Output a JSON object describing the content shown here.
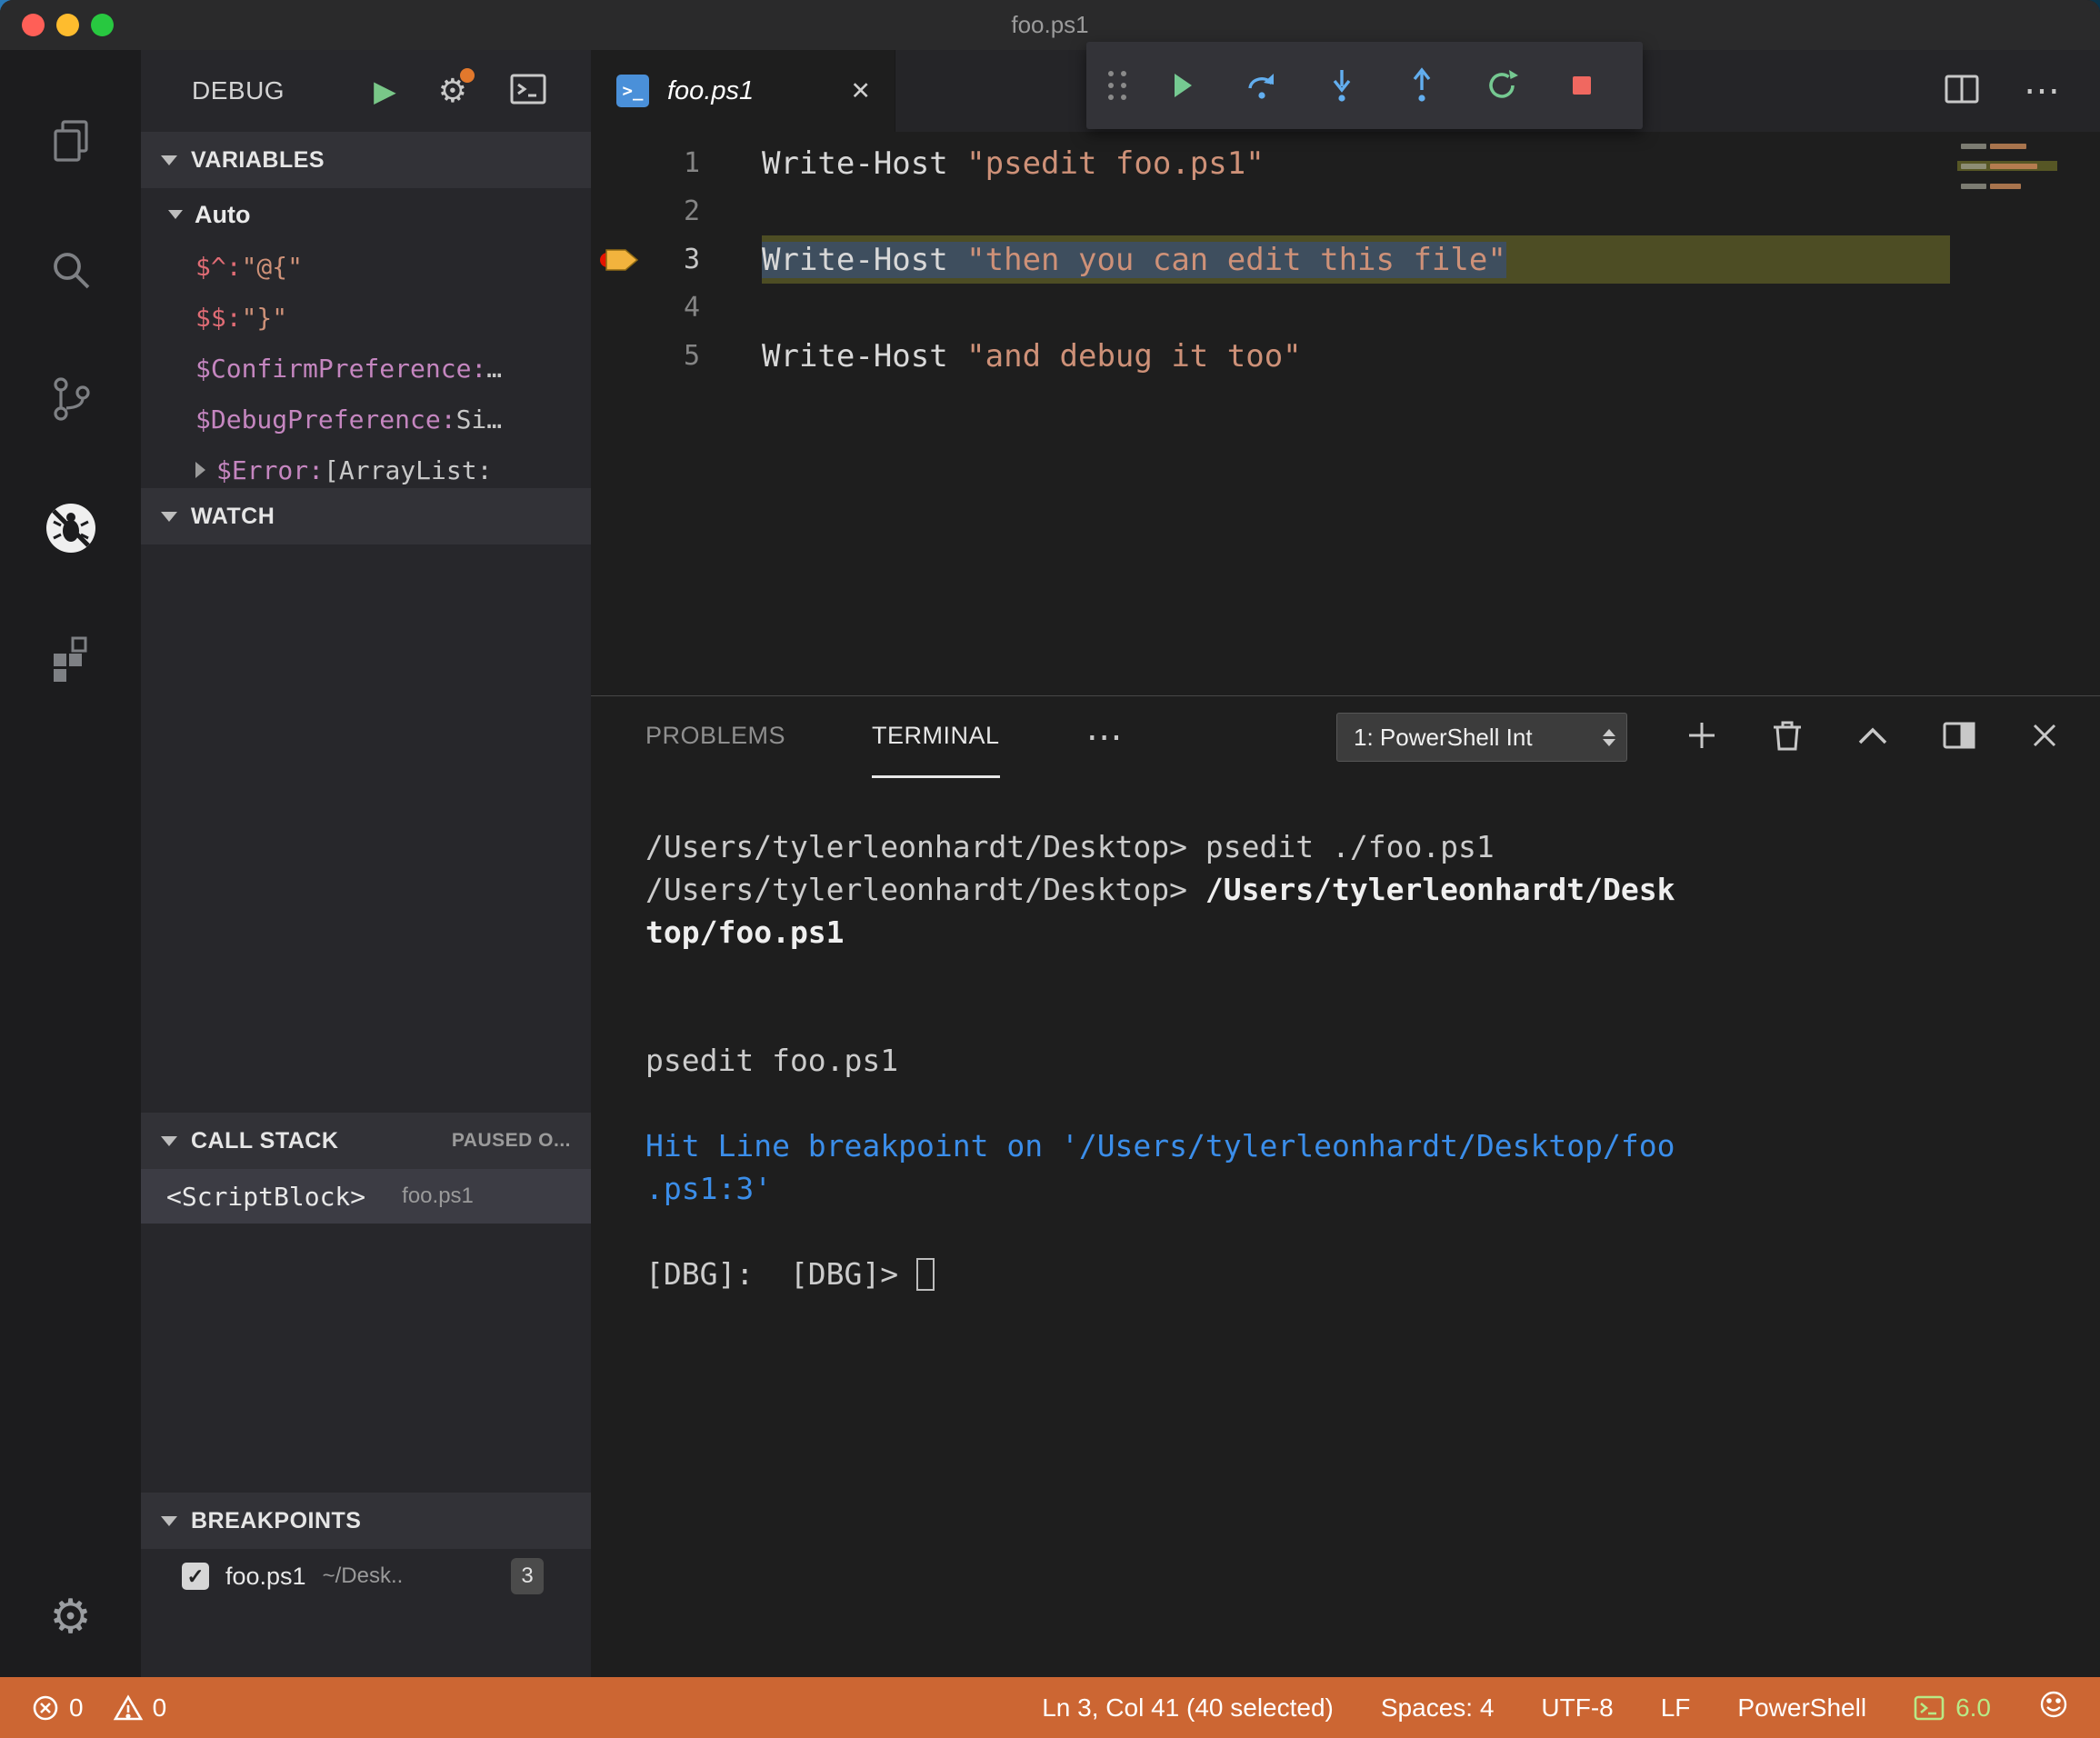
{
  "window": {
    "title": "foo.ps1"
  },
  "glyphs": {
    "play": "▶",
    "gear": "⚙",
    "close": "✕",
    "more": "⋯",
    "check": "✓",
    "ps_icon": ">_"
  },
  "sidebar": {
    "title": "DEBUG",
    "variables": {
      "header": "VARIABLES",
      "scope": "Auto",
      "items": [
        {
          "name": "$^:",
          "value": "\"@{\"",
          "name_color": "#e06c75",
          "value_color": "#ce9178"
        },
        {
          "name": "$$:",
          "value": "\"}\"",
          "name_color": "#e06c75",
          "value_color": "#ce9178"
        },
        {
          "name": "$ConfirmPreference:",
          "value": "…",
          "name_color": "#c586c0",
          "value_color": "#c8c8c8"
        },
        {
          "name": "$DebugPreference:",
          "value": "Si…",
          "name_color": "#c586c0",
          "value_color": "#c8c8c8"
        },
        {
          "name": "$Error:",
          "value": "[ArrayList:",
          "name_color": "#c586c0",
          "value_color": "#c8c8c8",
          "expandable": true
        }
      ]
    },
    "watch": {
      "header": "WATCH"
    },
    "call_stack": {
      "header": "CALL STACK",
      "status": "PAUSED O...",
      "frames": [
        {
          "name": "<ScriptBlock>",
          "file": "foo.ps1"
        }
      ]
    },
    "breakpoints": {
      "header": "BREAKPOINTS",
      "items": [
        {
          "checked": true,
          "file": "foo.ps1",
          "path": "~/Desk..",
          "line": "3"
        }
      ]
    }
  },
  "editor": {
    "tab": {
      "label": "foo.ps1"
    },
    "code_lines": [
      {
        "num": "1",
        "tokens": [
          {
            "text": "Write-Host ",
            "color": "#d8d8d8"
          },
          {
            "text": "\"psedit foo.ps1\"",
            "color": "#ce9178"
          }
        ]
      },
      {
        "num": "2",
        "tokens": []
      },
      {
        "num": "3",
        "breakpoint_hit": true,
        "selected": true,
        "tokens": [
          {
            "text": "Write-Host ",
            "color": "#d8d8d8"
          },
          {
            "text": "\"then you can edit this file\"",
            "color": "#ce9178"
          }
        ]
      },
      {
        "num": "4",
        "tokens": []
      },
      {
        "num": "5",
        "tokens": [
          {
            "text": "Write-Host ",
            "color": "#d8d8d8"
          },
          {
            "text": "\"and debug it too\"",
            "color": "#ce9178"
          }
        ]
      }
    ]
  },
  "panel": {
    "tabs": [
      {
        "label": "PROBLEMS",
        "active": false
      },
      {
        "label": "TERMINAL",
        "active": true
      }
    ],
    "terminal_select": "1: PowerShell Int",
    "terminal_lines": [
      {
        "segments": [
          {
            "text": "/Users/tylerleonhardt/Desktop> psedit ./foo.ps1",
            "color": "#cccccc"
          }
        ]
      },
      {
        "segments": [
          {
            "text": "/Users/tylerleonhardt/Desktop> ",
            "color": "#cccccc"
          },
          {
            "text": "/Users/tylerleonhardt/Desk",
            "color": "#efefef",
            "bold": true
          }
        ]
      },
      {
        "segments": [
          {
            "text": "top/foo.ps1",
            "color": "#efefef",
            "bold": true
          }
        ]
      },
      {
        "segments": []
      },
      {
        "segments": []
      },
      {
        "segments": [
          {
            "text": "psedit foo.ps1",
            "color": "#cccccc"
          }
        ]
      },
      {
        "segments": []
      },
      {
        "segments": [
          {
            "text": "Hit Line breakpoint on '/Users/tylerleonhardt/Desktop/foo",
            "color": "#3b8eea"
          }
        ]
      },
      {
        "segments": [
          {
            "text": ".ps1:3'",
            "color": "#3b8eea"
          }
        ]
      },
      {
        "segments": []
      },
      {
        "segments": [
          {
            "text": "[DBG]:  [DBG]> ",
            "color": "#cccccc"
          }
        ],
        "cursor": true
      }
    ]
  },
  "status_bar": {
    "errors": "0",
    "warnings": "0",
    "cursor_position": "Ln 3, Col 41 (40 selected)",
    "indentation": "Spaces: 4",
    "encoding": "UTF-8",
    "eol": "LF",
    "language": "PowerShell",
    "ps_version": "6.0",
    "background": "#cc6633"
  }
}
